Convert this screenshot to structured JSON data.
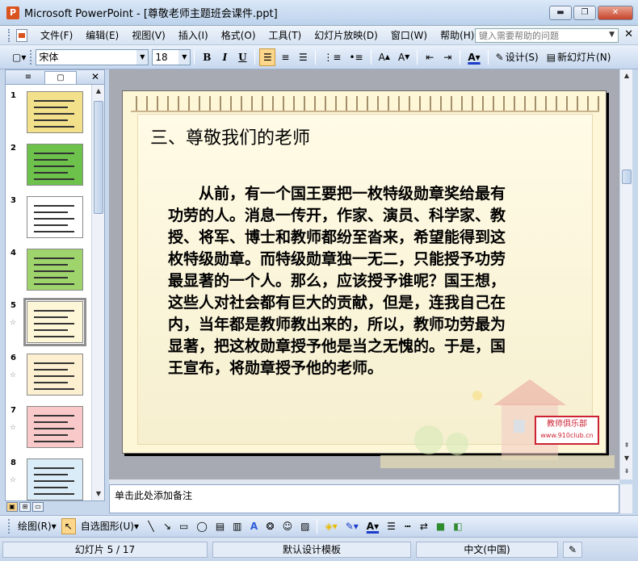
{
  "window": {
    "app_name": "Microsoft PowerPoint",
    "title": "Microsoft PowerPoint - [尊敬老师主题班会课件.ppt]",
    "min": "▬",
    "max": "❐",
    "close": "✕"
  },
  "menu": {
    "items": [
      "文件(F)",
      "编辑(E)",
      "视图(V)",
      "插入(I)",
      "格式(O)",
      "工具(T)",
      "幻灯片放映(D)",
      "窗口(W)",
      "帮助(H)"
    ],
    "help_placeholder": "键入需要帮助的问题",
    "close": "✕"
  },
  "toolbar": {
    "font_name": "宋体",
    "font_size": "18",
    "bold": "B",
    "italic": "I",
    "underline": "U",
    "design_label": "设计(S)",
    "new_slide_label": "新幻灯片(N)"
  },
  "slides_panel": {
    "tab_outline": "≡",
    "tab_slides": "▢",
    "close": "✕",
    "thumbnails": [
      {
        "num": "1",
        "star": "",
        "color": "#f2e08a"
      },
      {
        "num": "2",
        "star": "",
        "color": "#6cc24a"
      },
      {
        "num": "3",
        "star": "",
        "color": "#ffffff"
      },
      {
        "num": "4",
        "star": "",
        "color": "#9ed46b"
      },
      {
        "num": "5",
        "star": "☆",
        "color": "#fdf7d8"
      },
      {
        "num": "6",
        "star": "☆",
        "color": "#fdf0d0"
      },
      {
        "num": "7",
        "star": "☆",
        "color": "#f9c9c9"
      },
      {
        "num": "8",
        "star": "☆",
        "color": "#d9ecf7"
      }
    ]
  },
  "slide": {
    "title": "三、尊敬我们的老师",
    "body": "从前，有一个国王要把一枚特级勋章奖给最有功劳的人。消息一传开，作家、演员、科学家、教授、将军、博士和教师都纷至沓来，希望能得到这枚特级勋章。而特级勋章独一无二，只能授予功劳最显著的一个人。那么，应该授予谁呢？国王想，这些人对社会都有巨大的贡献，但是，连我自己在内，当年都是教师教出来的，所以，教师功劳最为显著，把这枚勋章授予他是当之无愧的。于是，国王宣布，将勋章授予他的老师。",
    "logo_text": "教师俱乐部",
    "logo_url": "www.910club.cn"
  },
  "notes": {
    "placeholder": "单击此处添加备注"
  },
  "drawing": {
    "draw_label": "绘图(R)",
    "autoshapes_label": "自选图形(U)"
  },
  "status": {
    "slide_info": "幻灯片 5 / 17",
    "template": "默认设计模板",
    "language": "中文(中国)"
  }
}
